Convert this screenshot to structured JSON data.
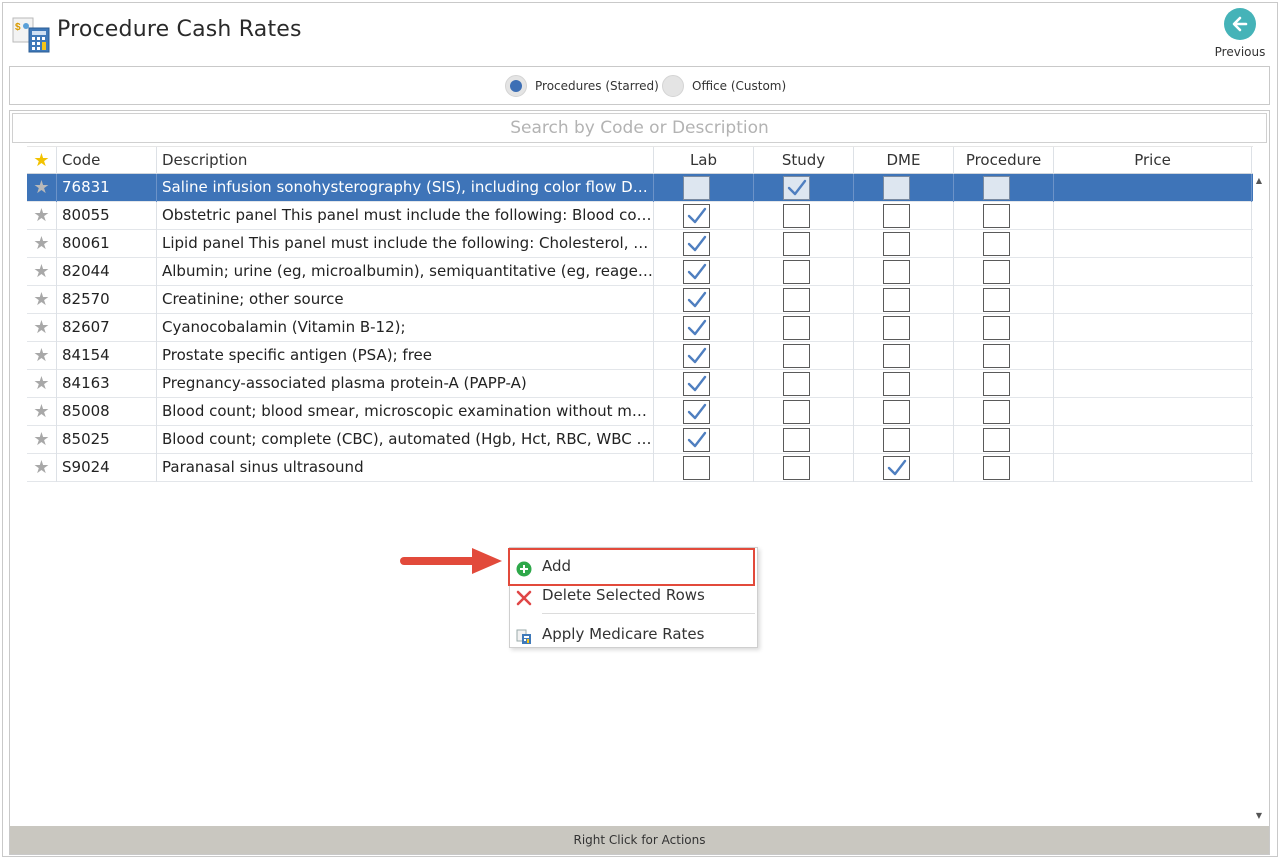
{
  "header": {
    "title": "Procedure Cash Rates",
    "previous_label": "Previous"
  },
  "filter": {
    "options": [
      {
        "label": "Procedures (Starred)",
        "selected": true
      },
      {
        "label": "Office (Custom)",
        "selected": false
      }
    ]
  },
  "search": {
    "placeholder": "Search by Code or Description"
  },
  "grid": {
    "columns": {
      "code": "Code",
      "description": "Description",
      "lab": "Lab",
      "study": "Study",
      "dme": "DME",
      "procedure": "Procedure",
      "price": "Price"
    },
    "rows": [
      {
        "code": "76831",
        "description": "Saline infusion sonohysterography (SIS), including color flow Doppl…",
        "lab": false,
        "study": true,
        "dme": false,
        "procedure": false,
        "price": "",
        "selected": true
      },
      {
        "code": "80055",
        "description": "Obstetric panel This panel must include the following: Blood count,…",
        "lab": true,
        "study": false,
        "dme": false,
        "procedure": false,
        "price": ""
      },
      {
        "code": "80061",
        "description": "Lipid panel This panel must include the following: Cholesterol, seru…",
        "lab": true,
        "study": false,
        "dme": false,
        "procedure": false,
        "price": ""
      },
      {
        "code": "82044",
        "description": "Albumin; urine (eg, microalbumin), semiquantitative (eg, reagent str…",
        "lab": true,
        "study": false,
        "dme": false,
        "procedure": false,
        "price": ""
      },
      {
        "code": "82570",
        "description": "Creatinine; other source",
        "lab": true,
        "study": false,
        "dme": false,
        "procedure": false,
        "price": ""
      },
      {
        "code": "82607",
        "description": "Cyanocobalamin (Vitamin B-12);",
        "lab": true,
        "study": false,
        "dme": false,
        "procedure": false,
        "price": ""
      },
      {
        "code": "84154",
        "description": "Prostate specific antigen (PSA); free",
        "lab": true,
        "study": false,
        "dme": false,
        "procedure": false,
        "price": ""
      },
      {
        "code": "84163",
        "description": "Pregnancy-associated plasma protein-A (PAPP-A)",
        "lab": true,
        "study": false,
        "dme": false,
        "procedure": false,
        "price": ""
      },
      {
        "code": "85008",
        "description": "Blood count; blood smear, microscopic examination without manua…",
        "lab": true,
        "study": false,
        "dme": false,
        "procedure": false,
        "price": ""
      },
      {
        "code": "85025",
        "description": "Blood count; complete (CBC), automated (Hgb, Hct, RBC, WBC and…",
        "lab": true,
        "study": false,
        "dme": false,
        "procedure": false,
        "price": ""
      },
      {
        "code": "S9024",
        "description": "Paranasal sinus ultrasound",
        "lab": false,
        "study": false,
        "dme": true,
        "procedure": false,
        "price": ""
      }
    ]
  },
  "context_menu": {
    "add": "Add",
    "delete": "Delete Selected Rows",
    "medicare": "Apply Medicare Rates"
  },
  "status_bar": {
    "text": "Right Click for Actions"
  },
  "colors": {
    "selected_row": "#3e74b8",
    "accent_teal": "#45b3b8",
    "highlight_red": "#e24a3b",
    "status_bar": "#c9c7c0"
  }
}
